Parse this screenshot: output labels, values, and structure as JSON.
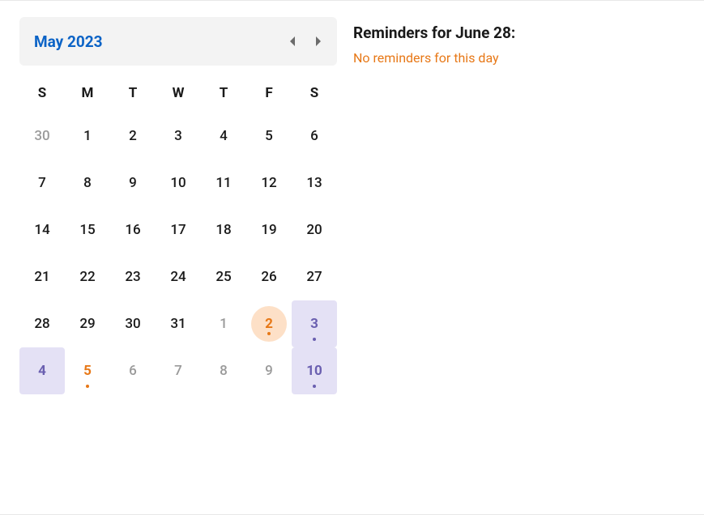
{
  "calendar": {
    "title": "May 2023",
    "dow": [
      "S",
      "M",
      "T",
      "W",
      "T",
      "F",
      "S"
    ],
    "cells": [
      {
        "n": "30",
        "other": true
      },
      {
        "n": "1"
      },
      {
        "n": "2"
      },
      {
        "n": "3"
      },
      {
        "n": "4"
      },
      {
        "n": "5"
      },
      {
        "n": "6"
      },
      {
        "n": "7"
      },
      {
        "n": "8"
      },
      {
        "n": "9"
      },
      {
        "n": "10"
      },
      {
        "n": "11"
      },
      {
        "n": "12"
      },
      {
        "n": "13"
      },
      {
        "n": "14"
      },
      {
        "n": "15"
      },
      {
        "n": "16"
      },
      {
        "n": "17"
      },
      {
        "n": "18"
      },
      {
        "n": "19"
      },
      {
        "n": "20"
      },
      {
        "n": "21"
      },
      {
        "n": "22"
      },
      {
        "n": "23"
      },
      {
        "n": "24"
      },
      {
        "n": "25"
      },
      {
        "n": "26"
      },
      {
        "n": "27"
      },
      {
        "n": "28"
      },
      {
        "n": "29"
      },
      {
        "n": "30"
      },
      {
        "n": "31"
      },
      {
        "n": "1",
        "other": true
      },
      {
        "n": "2",
        "other": true,
        "selected": true,
        "dot": "orange"
      },
      {
        "n": "3",
        "other": true,
        "hl": "purple",
        "dot": "purple"
      },
      {
        "n": "4",
        "other": true,
        "hl": "purple"
      },
      {
        "n": "5",
        "other": true,
        "hl": "orange",
        "dot": "orange"
      },
      {
        "n": "6",
        "other": true
      },
      {
        "n": "7",
        "other": true
      },
      {
        "n": "8",
        "other": true
      },
      {
        "n": "9",
        "other": true
      },
      {
        "n": "10",
        "other": true,
        "hl": "purple",
        "dot": "purple"
      }
    ]
  },
  "side": {
    "title": "Reminders for June 28:",
    "empty": "No reminders for this day"
  }
}
